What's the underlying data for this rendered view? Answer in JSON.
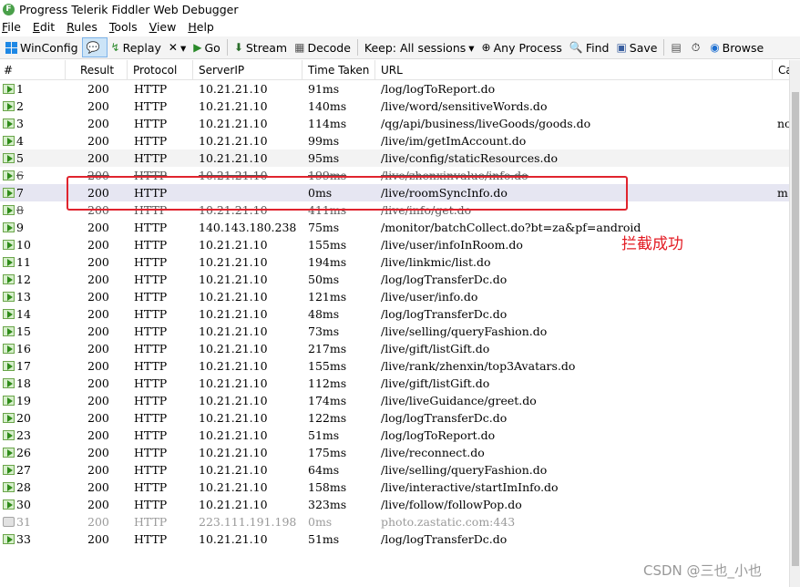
{
  "window": {
    "title": "Progress Telerik Fiddler Web Debugger",
    "icon_letter": "F"
  },
  "menu": [
    {
      "pre": "",
      "ul": "F",
      "post": "ile"
    },
    {
      "pre": "",
      "ul": "E",
      "post": "dit"
    },
    {
      "pre": "",
      "ul": "R",
      "post": "ules"
    },
    {
      "pre": "",
      "ul": "T",
      "post": "ools"
    },
    {
      "pre": "",
      "ul": "V",
      "post": "iew"
    },
    {
      "pre": "",
      "ul": "H",
      "post": "elp"
    }
  ],
  "toolbar": {
    "winconfig": "WinConfig",
    "replay": "Replay",
    "remove_glyph": "✕",
    "dropdown_glyph": "▾",
    "go": "Go",
    "stream": "Stream",
    "decode": "Decode",
    "keep_sessions": "Keep: All sessions",
    "any_process": "Any Process",
    "find": "Find",
    "save": "Save",
    "browse": "Browse"
  },
  "columns": {
    "num": "#",
    "result": "Result",
    "protocol": "Protocol",
    "server_ip": "ServerIP",
    "time_taken": "Time Taken",
    "url": "URL",
    "extra": "Ca"
  },
  "sessions": [
    {
      "num": "1",
      "result": "200",
      "protocol": "HTTP",
      "ip": "10.21.21.10",
      "time": "91ms",
      "url": "/log/logToReport.do",
      "extra": "",
      "style": ""
    },
    {
      "num": "2",
      "result": "200",
      "protocol": "HTTP",
      "ip": "10.21.21.10",
      "time": "140ms",
      "url": "/live/word/sensitiveWords.do",
      "extra": "",
      "style": ""
    },
    {
      "num": "3",
      "result": "200",
      "protocol": "HTTP",
      "ip": "10.21.21.10",
      "time": "114ms",
      "url": "/qg/api/business/liveGoods/goods.do",
      "extra": "nc",
      "style": ""
    },
    {
      "num": "4",
      "result": "200",
      "protocol": "HTTP",
      "ip": "10.21.21.10",
      "time": "99ms",
      "url": "/live/im/getImAccount.do",
      "extra": "",
      "style": ""
    },
    {
      "num": "5",
      "result": "200",
      "protocol": "HTTP",
      "ip": "10.21.21.10",
      "time": "95ms",
      "url": "/live/config/staticResources.do",
      "extra": "",
      "style": "alt"
    },
    {
      "num": "6",
      "result": "200",
      "protocol": "HTTP",
      "ip": "10.21.21.10",
      "time": "199ms",
      "url": "/live/zhenxinvalue/info.do",
      "extra": "",
      "style": "strike"
    },
    {
      "num": "7",
      "result": "200",
      "protocol": "HTTP",
      "ip": "",
      "time": "0ms",
      "url": "/live/roomSyncInfo.do",
      "extra": "m",
      "style": "sel"
    },
    {
      "num": "8",
      "result": "200",
      "protocol": "HTTP",
      "ip": "10.21.21.10",
      "time": "411ms",
      "url": "/live/info/get.do",
      "extra": "",
      "style": "strike"
    },
    {
      "num": "9",
      "result": "200",
      "protocol": "HTTP",
      "ip": "140.143.180.238",
      "time": "75ms",
      "url": "/monitor/batchCollect.do?bt=za&pf=android",
      "extra": "",
      "style": ""
    },
    {
      "num": "10",
      "result": "200",
      "protocol": "HTTP",
      "ip": "10.21.21.10",
      "time": "155ms",
      "url": "/live/user/infoInRoom.do",
      "extra": "",
      "style": ""
    },
    {
      "num": "11",
      "result": "200",
      "protocol": "HTTP",
      "ip": "10.21.21.10",
      "time": "194ms",
      "url": "/live/linkmic/list.do",
      "extra": "",
      "style": ""
    },
    {
      "num": "12",
      "result": "200",
      "protocol": "HTTP",
      "ip": "10.21.21.10",
      "time": "50ms",
      "url": "/log/logTransferDc.do",
      "extra": "",
      "style": ""
    },
    {
      "num": "13",
      "result": "200",
      "protocol": "HTTP",
      "ip": "10.21.21.10",
      "time": "121ms",
      "url": "/live/user/info.do",
      "extra": "",
      "style": ""
    },
    {
      "num": "14",
      "result": "200",
      "protocol": "HTTP",
      "ip": "10.21.21.10",
      "time": "48ms",
      "url": "/log/logTransferDc.do",
      "extra": "",
      "style": ""
    },
    {
      "num": "15",
      "result": "200",
      "protocol": "HTTP",
      "ip": "10.21.21.10",
      "time": "73ms",
      "url": "/live/selling/queryFashion.do",
      "extra": "",
      "style": ""
    },
    {
      "num": "16",
      "result": "200",
      "protocol": "HTTP",
      "ip": "10.21.21.10",
      "time": "217ms",
      "url": "/live/gift/listGift.do",
      "extra": "",
      "style": ""
    },
    {
      "num": "17",
      "result": "200",
      "protocol": "HTTP",
      "ip": "10.21.21.10",
      "time": "155ms",
      "url": "/live/rank/zhenxin/top3Avatars.do",
      "extra": "",
      "style": ""
    },
    {
      "num": "18",
      "result": "200",
      "protocol": "HTTP",
      "ip": "10.21.21.10",
      "time": "112ms",
      "url": "/live/gift/listGift.do",
      "extra": "",
      "style": ""
    },
    {
      "num": "19",
      "result": "200",
      "protocol": "HTTP",
      "ip": "10.21.21.10",
      "time": "174ms",
      "url": "/live/liveGuidance/greet.do",
      "extra": "",
      "style": ""
    },
    {
      "num": "20",
      "result": "200",
      "protocol": "HTTP",
      "ip": "10.21.21.10",
      "time": "122ms",
      "url": "/log/logTransferDc.do",
      "extra": "",
      "style": ""
    },
    {
      "num": "23",
      "result": "200",
      "protocol": "HTTP",
      "ip": "10.21.21.10",
      "time": "51ms",
      "url": "/log/logToReport.do",
      "extra": "",
      "style": ""
    },
    {
      "num": "26",
      "result": "200",
      "protocol": "HTTP",
      "ip": "10.21.21.10",
      "time": "175ms",
      "url": "/live/reconnect.do",
      "extra": "",
      "style": ""
    },
    {
      "num": "27",
      "result": "200",
      "protocol": "HTTP",
      "ip": "10.21.21.10",
      "time": "64ms",
      "url": "/live/selling/queryFashion.do",
      "extra": "",
      "style": ""
    },
    {
      "num": "28",
      "result": "200",
      "protocol": "HTTP",
      "ip": "10.21.21.10",
      "time": "158ms",
      "url": "/live/interactive/startImInfo.do",
      "extra": "",
      "style": ""
    },
    {
      "num": "30",
      "result": "200",
      "protocol": "HTTP",
      "ip": "10.21.21.10",
      "time": "323ms",
      "url": "/live/follow/followPop.do",
      "extra": "",
      "style": ""
    },
    {
      "num": "31",
      "result": "200",
      "protocol": "HTTP",
      "ip": "223.111.191.198",
      "time": "0ms",
      "url": "photo.zastatic.com:443",
      "extra": "",
      "style": "dim"
    },
    {
      "num": "33",
      "result": "200",
      "protocol": "HTTP",
      "ip": "10.21.21.10",
      "time": "51ms",
      "url": "/log/logTransferDc.do",
      "extra": "",
      "style": ""
    }
  ],
  "annotation": "拦截成功",
  "watermark": "CSDN @三也_小也",
  "colors": {
    "highlight": "#e0242e",
    "annotation": "#e31b23",
    "selected_row": "#e6e6f2"
  }
}
